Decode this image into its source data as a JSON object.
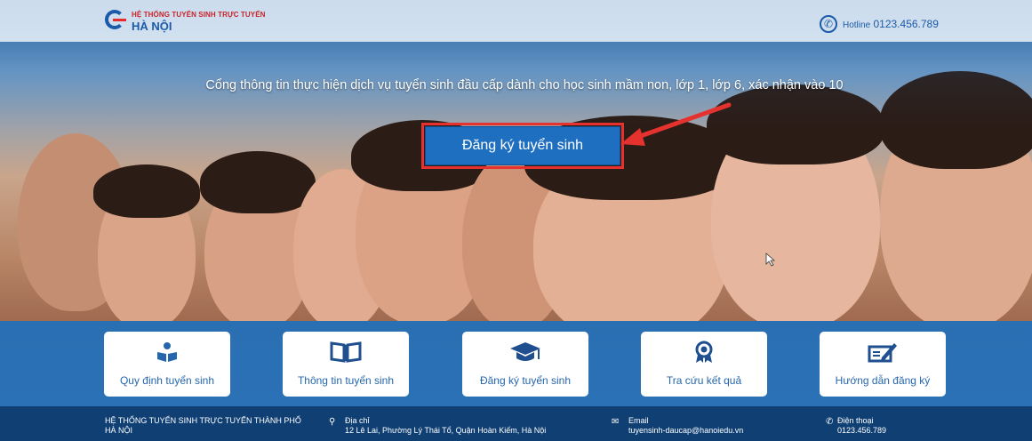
{
  "header": {
    "logo_line1": "HỆ THỐNG TUYỂN SINH TRỰC TUYẾN",
    "logo_line2": "HÀ NỘI",
    "hotline_label": "Hotline",
    "hotline_number": "0123.456.789"
  },
  "hero": {
    "tagline": "Cổng thông tin thực hiện dịch vụ tuyển sinh đầu cấp dành cho học sinh mầm non, lớp 1, lớp 6, xác nhận vào 10",
    "cta_label": "Đăng ký tuyển sinh"
  },
  "tiles": [
    {
      "label": "Quy định tuyển sinh",
      "icon": "reading-person-icon"
    },
    {
      "label": "Thông tin tuyển sinh",
      "icon": "open-book-icon"
    },
    {
      "label": "Đăng ký tuyển sinh",
      "icon": "graduation-cap-icon"
    },
    {
      "label": "Tra cứu kết quả",
      "icon": "award-ribbon-icon"
    },
    {
      "label": "Hướng dẫn đăng ký",
      "icon": "edit-form-icon"
    }
  ],
  "footer": {
    "org_name": "HỆ THỐNG TUYỂN SINH TRỰC TUYẾN THÀNH PHỐ HÀ NỘI",
    "address_label": "Địa chỉ",
    "address_value": "12 Lê Lai, Phường Lý Thái Tổ, Quận Hoàn Kiếm, Hà Nội",
    "email_label": "Email",
    "email_value": "tuyensinh-daucap@hanoiedu.vn",
    "phone_label": "Điện thoại",
    "phone_value": "0123.456.789"
  },
  "colors": {
    "brand_blue": "#1a5aa8",
    "brand_red": "#c8232a",
    "band_blue": "#2b71b6",
    "footer_navy": "#0f3f73",
    "annotation_red": "#e5322f"
  }
}
